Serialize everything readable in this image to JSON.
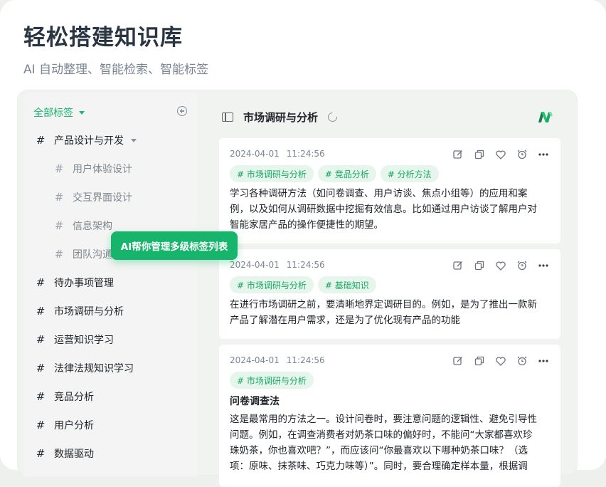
{
  "hero": {
    "title": "轻松搭建知识库",
    "subtitle": "AI 自动整理、智能检索、智能标签"
  },
  "sidebar": {
    "header": "全部标签",
    "items": [
      {
        "label": "产品设计与开发",
        "level": 1,
        "expanded": true
      },
      {
        "label": "用户体验设计",
        "level": 2
      },
      {
        "label": "交互界面设计",
        "level": 2
      },
      {
        "label": "信息架构",
        "level": 2
      },
      {
        "label": "团队沟通",
        "level": 2
      },
      {
        "label": "待办事项管理",
        "level": 1
      },
      {
        "label": "市场调研与分析",
        "level": 1
      },
      {
        "label": "运营知识学习",
        "level": 1
      },
      {
        "label": "法律法规知识学习",
        "level": 1
      },
      {
        "label": "竞品分析",
        "level": 1
      },
      {
        "label": "用户分析",
        "level": 1
      },
      {
        "label": "数据驱动",
        "level": 1
      }
    ]
  },
  "tooltip": "AI帮你管理多级标签列表",
  "main": {
    "title": "市场调研与分析",
    "notes": [
      {
        "date": "2024-04-01",
        "time": "11:24:56",
        "tags": [
          "# 市场调研与分析",
          "# 竞品分析",
          "# 分析方法"
        ],
        "lines": [
          "学习各种调研方法（如问卷调查、用户访谈、焦点小组等）的应用和案",
          "例，以及如何从调研数据中挖掘有效信息。比如通过用户访谈了解用户对",
          "智能家居产品的操作便捷性的期望。"
        ]
      },
      {
        "date": "2024-04-01",
        "time": "11:24:56",
        "tags": [
          "# 市场调研与分析",
          "# 基础知识"
        ],
        "lines": [
          "在进行市场调研之前，要清晰地界定调研目的。例如，是为了推出一款新",
          "产品了解潜在用户需求，还是为了优化现有产品的功能"
        ]
      },
      {
        "date": "2024-04-01",
        "time": "11:24:56",
        "tags": [
          "# 市场调研与分析"
        ],
        "heading": "问卷调查法",
        "lines": [
          "这是最常用的方法之一。设计问卷时，要注意问题的逻辑性、避免引导性",
          "问题。例如，在调查消费者对奶茶口味的偏好时，不能问“大家都喜欢珍",
          "珠奶茶，你也喜欢吧？”，而应该问“你最喜欢以下哪种奶茶口味？（选",
          "项：原味、抹茶味、巧克力味等）”。同时，要合理确定样本量，根据调"
        ]
      }
    ]
  },
  "colors": {
    "accent": "#18b66e",
    "tag_bg": "#e6f6ec",
    "tooltip_bg": "#17b46c"
  }
}
